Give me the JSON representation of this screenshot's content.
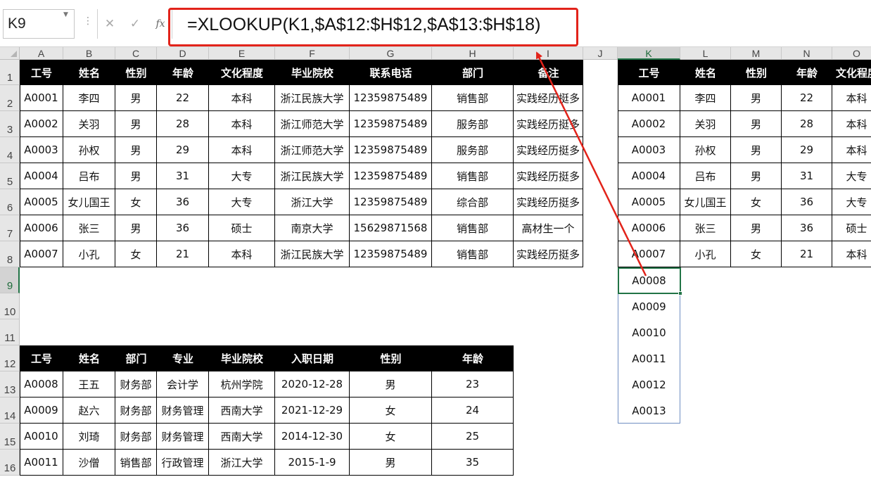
{
  "formula_bar": {
    "name_box": "K9",
    "cancel_glyph": "✕",
    "enter_glyph": "✓",
    "fx_glyph": "fx",
    "formula": "=XLOOKUP(K1,$A$12:$H$12,$A$13:$H$18)"
  },
  "columns": [
    "A",
    "B",
    "C",
    "D",
    "E",
    "F",
    "G",
    "H",
    "I",
    "J",
    "K",
    "L",
    "M",
    "N",
    "O"
  ],
  "rows": [
    "1",
    "2",
    "3",
    "4",
    "5",
    "6",
    "7",
    "8",
    "9",
    "10",
    "11",
    "12",
    "13",
    "14",
    "15",
    "16"
  ],
  "table1": {
    "headers": [
      "工号",
      "姓名",
      "性别",
      "年龄",
      "文化程度",
      "毕业院校",
      "联系电话",
      "部门",
      "备注"
    ],
    "rows": [
      [
        "A0001",
        "李四",
        "男",
        "22",
        "本科",
        "浙江民族大学",
        "12359875489",
        "销售部",
        "实践经历挺多"
      ],
      [
        "A0002",
        "关羽",
        "男",
        "28",
        "本科",
        "浙江师范大学",
        "12359875489",
        "服务部",
        "实践经历挺多"
      ],
      [
        "A0003",
        "孙权",
        "男",
        "29",
        "本科",
        "浙江师范大学",
        "12359875489",
        "服务部",
        "实践经历挺多"
      ],
      [
        "A0004",
        "吕布",
        "男",
        "31",
        "大专",
        "浙江民族大学",
        "12359875489",
        "销售部",
        "实践经历挺多"
      ],
      [
        "A0005",
        "女儿国王",
        "女",
        "36",
        "大专",
        "浙江大学",
        "12359875489",
        "综合部",
        "实践经历挺多"
      ],
      [
        "A0006",
        "张三",
        "男",
        "36",
        "硕士",
        "南京大学",
        "15629871568",
        "销售部",
        "高材生一个"
      ],
      [
        "A0007",
        "小孔",
        "女",
        "21",
        "本科",
        "浙江民族大学",
        "12359875489",
        "销售部",
        "实践经历挺多"
      ]
    ]
  },
  "table2": {
    "headers": [
      "工号",
      "姓名",
      "部门",
      "专业",
      "毕业院校",
      "入职日期",
      "性别",
      "年龄"
    ],
    "rows": [
      [
        "A0008",
        "王五",
        "财务部",
        "会计学",
        "杭州学院",
        "2020-12-28",
        "男",
        "23"
      ],
      [
        "A0009",
        "赵六",
        "财务部",
        "财务管理",
        "西南大学",
        "2021-12-29",
        "女",
        "24"
      ],
      [
        "A0010",
        "刘琦",
        "财务部",
        "财务管理",
        "西南大学",
        "2014-12-30",
        "女",
        "25"
      ],
      [
        "A0011",
        "沙僧",
        "销售部",
        "行政管理",
        "浙江大学",
        "2015-1-9",
        "男",
        "35"
      ]
    ]
  },
  "table3": {
    "headers": [
      "工号",
      "姓名",
      "性别",
      "年龄",
      "文化程度"
    ],
    "rows": [
      [
        "A0001",
        "李四",
        "男",
        "22",
        "本科"
      ],
      [
        "A0002",
        "关羽",
        "男",
        "28",
        "本科"
      ],
      [
        "A0003",
        "孙权",
        "男",
        "29",
        "本科"
      ],
      [
        "A0004",
        "吕布",
        "男",
        "31",
        "大专"
      ],
      [
        "A0005",
        "女儿国王",
        "女",
        "36",
        "大专"
      ],
      [
        "A0006",
        "张三",
        "男",
        "36",
        "硕士"
      ],
      [
        "A0007",
        "小孔",
        "女",
        "21",
        "本科"
      ]
    ]
  },
  "lookup_ids": [
    "A0008",
    "A0009",
    "A0010",
    "A0011",
    "A0012",
    "A0013"
  ],
  "colors": {
    "highlight": "#e2231a",
    "selection": "#217346",
    "header_bg": "#000000"
  }
}
